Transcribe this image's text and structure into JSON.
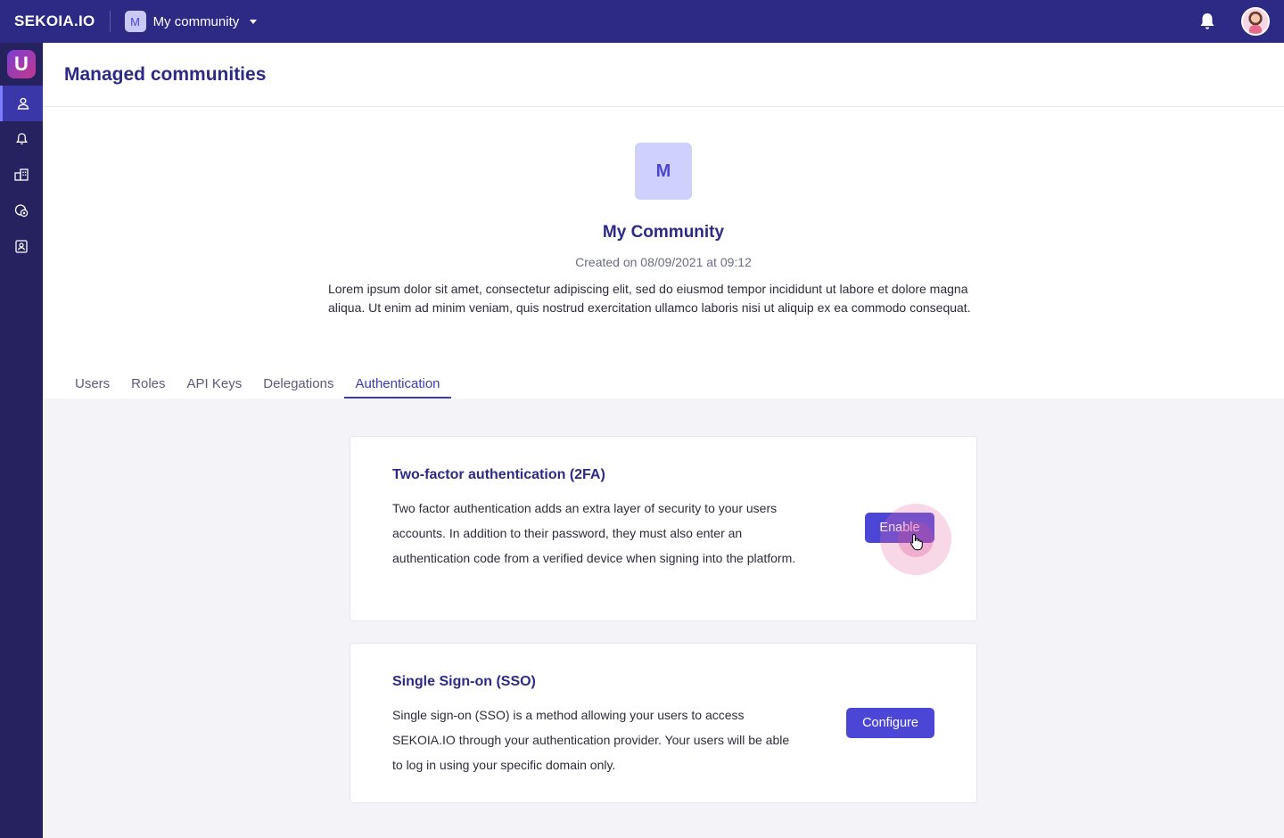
{
  "topbar": {
    "brand": "SEKOIA.IO",
    "community_initial": "M",
    "community_name": "My community",
    "notifications_icon": "bell-icon",
    "avatar_icon": "user-avatar"
  },
  "sidebar": {
    "app_initial": "U",
    "items": [
      {
        "icon": "user-icon",
        "active": true
      },
      {
        "icon": "bell-icon",
        "active": false
      },
      {
        "icon": "buildings-icon",
        "active": false
      },
      {
        "icon": "shield-gear-icon",
        "active": false
      },
      {
        "icon": "contact-card-icon",
        "active": false
      }
    ]
  },
  "page": {
    "title": "Managed communities"
  },
  "profile": {
    "initial": "M",
    "name": "My Community",
    "created": "Created on 08/09/2021 at 09:12",
    "description": "Lorem ipsum dolor sit amet, consectetur adipiscing elit, sed do eiusmod tempor incididunt ut labore et dolore magna aliqua. Ut enim ad minim veniam, quis nostrud exercitation ullamco laboris nisi ut aliquip ex ea commodo consequat."
  },
  "tabs": [
    {
      "label": "Users",
      "active": false
    },
    {
      "label": "Roles",
      "active": false
    },
    {
      "label": "API Keys",
      "active": false
    },
    {
      "label": "Delegations",
      "active": false
    },
    {
      "label": "Authentication",
      "active": true
    }
  ],
  "cards": {
    "two_factor": {
      "title": "Two-factor authentication (2FA)",
      "description": "Two factor authentication adds an extra layer of security to your users accounts. In addition to their password, they must also enter an authentication code from a verified device when signing into the platform.",
      "button_label": "Enable"
    },
    "sso": {
      "title": "Single Sign-on (SSO)",
      "description": "Single sign-on (SSO) is a method allowing your users to access SEKOIA.IO through your authentication provider. Your users will be able to log in using your specific domain only.",
      "button_label": "Configure"
    }
  },
  "colors": {
    "topbar": "#2d2a86",
    "sidebar": "#25225f",
    "accent": "#4b46d6",
    "title": "#2d2a86"
  }
}
